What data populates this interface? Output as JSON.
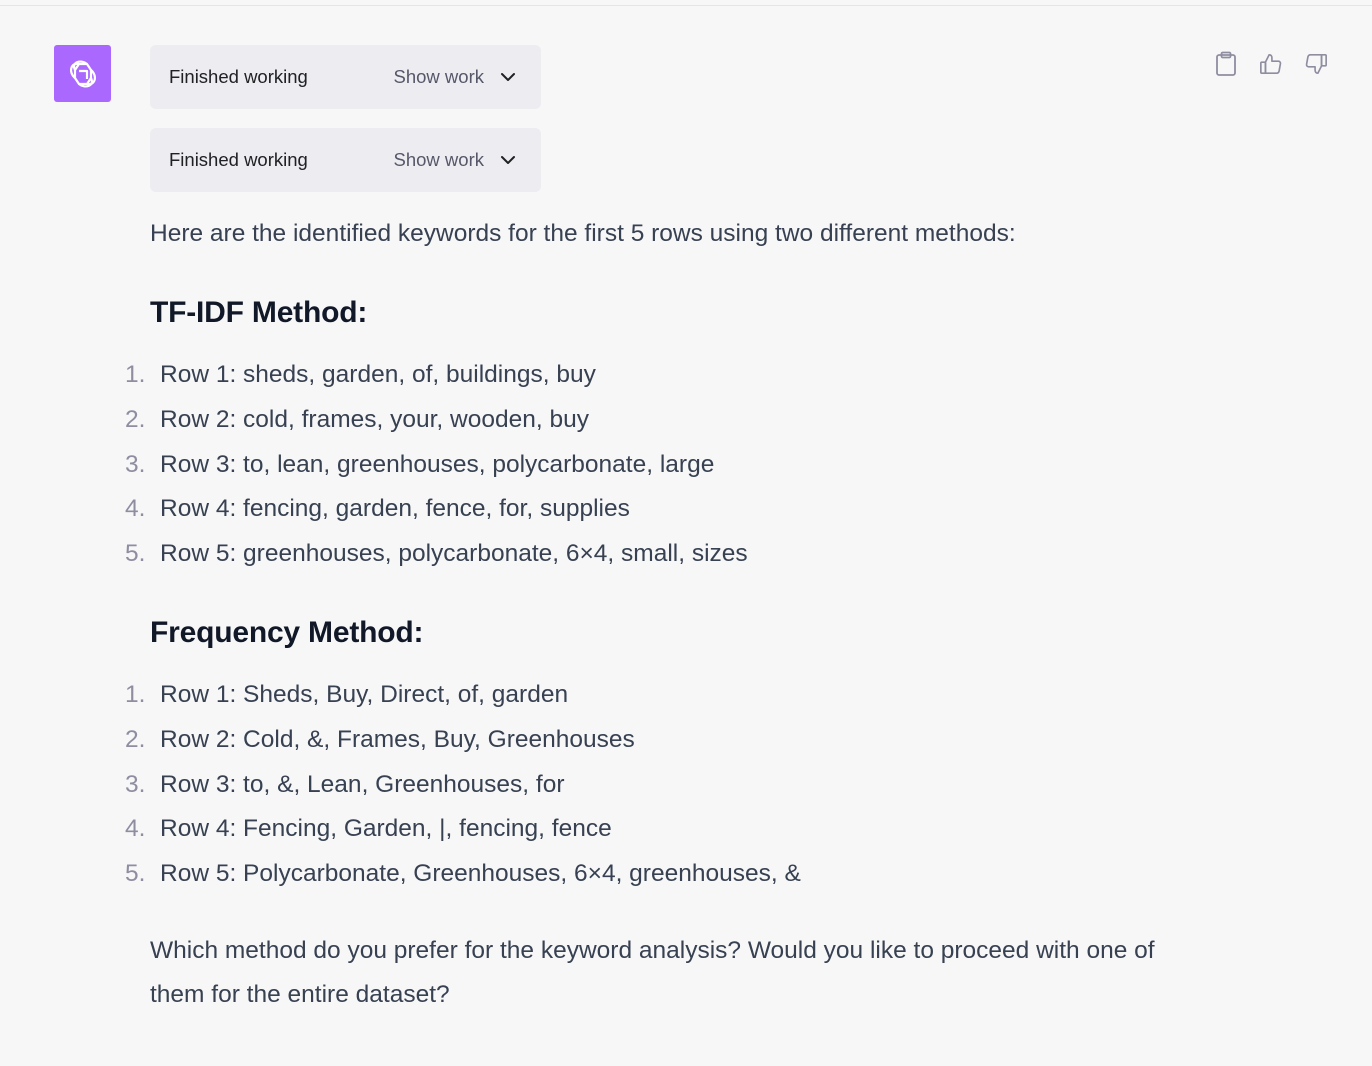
{
  "colors": {
    "avatar_bg": "#ab68ff",
    "page_bg": "#f7f7f8",
    "work_box_bg": "#ececf1"
  },
  "avatar": {
    "icon": "openai-logo-icon"
  },
  "work_boxes": [
    {
      "status": "Finished working",
      "toggle_label": "Show work",
      "icon": "chevron-down-icon"
    },
    {
      "status": "Finished working",
      "toggle_label": "Show work",
      "icon": "chevron-down-icon"
    }
  ],
  "actions": {
    "copy_icon": "clipboard-icon",
    "like_icon": "thumbs-up-icon",
    "dislike_icon": "thumbs-down-icon"
  },
  "message": {
    "intro": "Here are the identified keywords for the first 5 rows using two different methods:",
    "sections": [
      {
        "heading": "TF-IDF Method:",
        "items": [
          {
            "num": "1.",
            "text": "Row 1: sheds, garden, of, buildings, buy"
          },
          {
            "num": "2.",
            "text": "Row 2: cold, frames, your, wooden, buy"
          },
          {
            "num": "3.",
            "text": "Row 3: to, lean, greenhouses, polycarbonate, large"
          },
          {
            "num": "4.",
            "text": "Row 4: fencing, garden, fence, for, supplies"
          },
          {
            "num": "5.",
            "text": "Row 5: greenhouses, polycarbonate, 6×4, small, sizes"
          }
        ]
      },
      {
        "heading": "Frequency Method:",
        "items": [
          {
            "num": "1.",
            "text": "Row 1: Sheds, Buy, Direct, of, garden"
          },
          {
            "num": "2.",
            "text": "Row 2: Cold, &, Frames, Buy, Greenhouses"
          },
          {
            "num": "3.",
            "text": "Row 3: to, &, Lean, Greenhouses, for"
          },
          {
            "num": "4.",
            "text": "Row 4: Fencing, Garden, |, fencing, fence"
          },
          {
            "num": "5.",
            "text": "Row 5: Polycarbonate, Greenhouses, 6×4, greenhouses, &"
          }
        ]
      }
    ],
    "closing_line_1": "Which method do you prefer for the keyword analysis? Would you like to proceed with one of",
    "closing_line_2": "them for the entire dataset?"
  }
}
